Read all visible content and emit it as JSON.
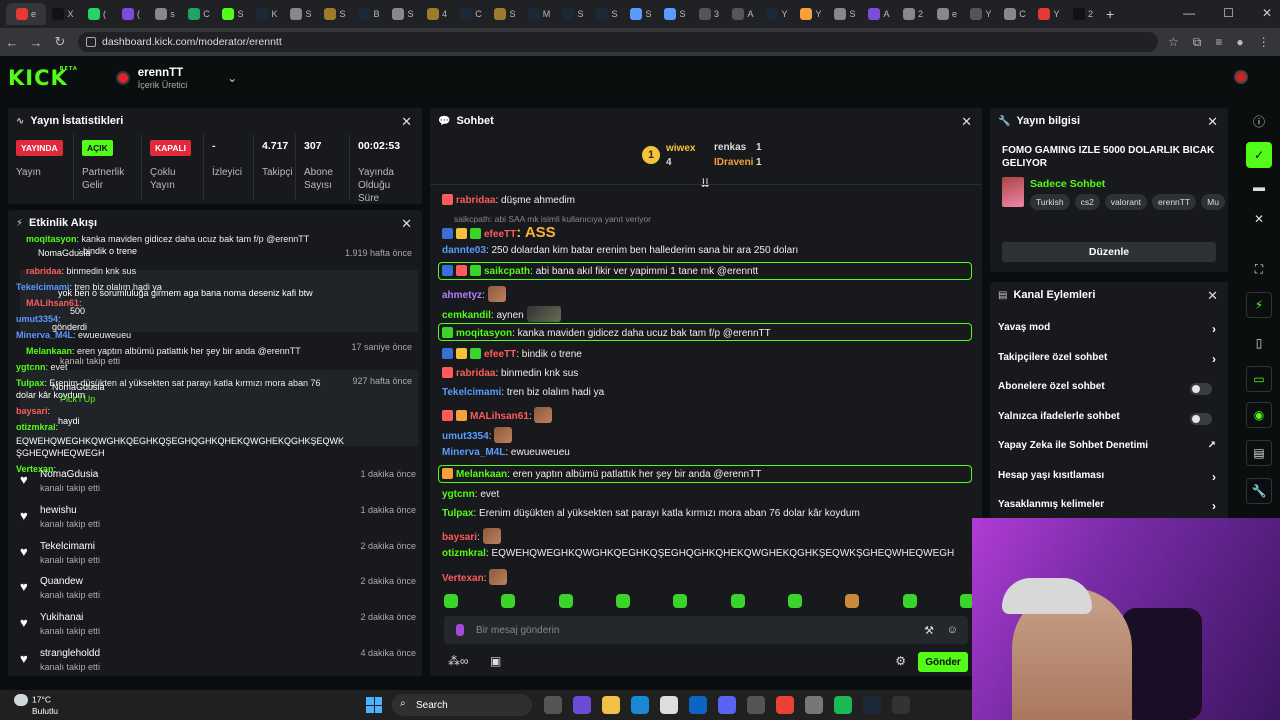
{
  "browser": {
    "url": "dashboard.kick.com/moderator/erenntt",
    "tabs": [
      "e",
      "X",
      "(",
      "(",
      "s",
      "C",
      "S",
      "K",
      "S",
      "S",
      "B",
      "S",
      "4",
      "C",
      "S",
      "M",
      "S",
      "S",
      "S",
      "S",
      "3",
      "A",
      "Y",
      "Y",
      "S",
      "A",
      "2",
      "e",
      "Y",
      "C",
      "Y",
      "2"
    ],
    "new_tab": "+"
  },
  "header": {
    "logo": "KICK",
    "logo_badge": "BETA",
    "channel_name": "erennTT",
    "channel_role": "İçerik Üretici"
  },
  "stats": {
    "title": "Yayın İstatistikleri",
    "items": [
      {
        "badge": "YAYINDA",
        "badge_color": "#e02a3b",
        "label": "Yayın"
      },
      {
        "badge": "AÇIK",
        "badge_color": "#53fc18",
        "label": "Partnerlik Gelir"
      },
      {
        "badge": "KAPALI",
        "badge_color": "#e02a3b",
        "label": "Çoklu Yayın"
      },
      {
        "value": "-",
        "label": "İzleyici"
      },
      {
        "value": "4.717",
        "label": "Takipçi"
      },
      {
        "value": "307",
        "label": "Abone Sayısı"
      },
      {
        "value": "00:02:53",
        "label": "Yayında Olduğu Süre"
      }
    ]
  },
  "activity": {
    "title": "Etkinlik Akışı",
    "overlay": [
      {
        "user": "moqitasyon",
        "color": "#53fc18",
        "text": ": kanka maviden gidicez daha ucuz bak tam f/p @erennTT"
      },
      {
        "user": "",
        "color": "#fff",
        "text": "NomaGdusia"
      },
      {
        "user": "",
        "color": "#fff",
        "text": ": bindik o trene"
      },
      {
        "user": "rabridaa",
        "color": "#ff5b5b",
        "text": ": binmedin knk sus"
      },
      {
        "user": "Tekelcimami",
        "color": "#5b9bff",
        "text": ": tren biz olalım hadi ya"
      },
      {
        "user": "",
        "color": "#fff",
        "text": "yok ben o sorumluluğa girmem aga bana noma deseniz kafi btw"
      },
      {
        "user": "MALihsan61",
        "color": "#ff5b5b",
        "text": ":"
      },
      {
        "user": "umut3354",
        "color": "#5b9bff",
        "text": ":"
      },
      {
        "user": "",
        "color": "#fff",
        "text": "500"
      },
      {
        "user": "",
        "color": "#fff",
        "text": "gönderdi"
      },
      {
        "user": "Minerva_M4L",
        "color": "#5b9bff",
        "text": ": ewueuweueu"
      },
      {
        "user": "Melankaan",
        "color": "#53fc18",
        "text": ": eren yaptın albümü patlattık her şey bir anda @erennTT"
      },
      {
        "user": "ygtcnn",
        "color": "#53fc18",
        "text": ": evet"
      },
      {
        "user": "",
        "color": "#bbb",
        "text": "kanalı takip etti"
      },
      {
        "user": "Tulpax",
        "color": "#53fc18",
        "text": ": Erenim düşükten al yüksekten sat parayı katla kırmızı mora aban 76"
      },
      {
        "user": "",
        "color": "#fff",
        "text": "dolar kâr koydum"
      },
      {
        "user": "",
        "color": "#fff",
        "text": "NomaGdusia"
      },
      {
        "user": "",
        "color": "#53fc18",
        "text": "Pick'I Up"
      },
      {
        "user": "baysari",
        "color": "#ff5b5b",
        "text": ":"
      },
      {
        "user": "",
        "color": "#fff",
        "text": "haydi"
      },
      {
        "user": "otizmkral",
        "color": "#53fc18",
        "text": ":"
      },
      {
        "user": "",
        "color": "#fff",
        "text": "EQWEHQWEGHKQWGHKQEGHKQŞEGHQGHKQHEKQWGHEKQGHKŞEQWK"
      },
      {
        "user": "",
        "color": "#fff",
        "text": "ŞGHEQWHEQWEGH"
      },
      {
        "user": "Vertexan",
        "color": "#53fc18",
        "text": ":"
      }
    ],
    "times": [
      "1.919 hafta önce",
      "17 saniye önce",
      "927 hafta önce"
    ],
    "follows": [
      {
        "name": "NomaGdusia",
        "event": "kanalı takip etti",
        "time": "1 dakika önce"
      },
      {
        "name": "hewishu",
        "event": "kanalı takip etti",
        "time": "1 dakika önce"
      },
      {
        "name": "Tekelcimami",
        "event": "kanalı takip etti",
        "time": "2 dakika önce"
      },
      {
        "name": "Quandew",
        "event": "kanalı takip etti",
        "time": "2 dakika önce"
      },
      {
        "name": "Yukihanai",
        "event": "kanalı takip etti",
        "time": "2 dakika önce"
      },
      {
        "name": "strangleholdd",
        "event": "kanalı takip etti",
        "time": "4 dakika önce"
      }
    ]
  },
  "chat": {
    "title": "Sohbet",
    "leaderboard": [
      {
        "rank": "1",
        "name": "wiwex",
        "count": "4",
        "color": "#f4c33c"
      },
      {
        "name": "renkas",
        "count": "1",
        "color": "#ddd"
      },
      {
        "name": "IDraveni",
        "count": "1",
        "color": "#f4a13c"
      }
    ],
    "messages": [
      {
        "user": "rabridaa",
        "color": "#ff5b5b",
        "text": ": düşme ahmedim"
      },
      {
        "user": "",
        "color": "#888",
        "text": "saikcpath: abi SAA mk isimli kullanıcıya yanıt veriyor"
      },
      {
        "user": "efeeTT",
        "color": "#ff5b5b",
        "text": ": ASS"
      },
      {
        "user": "dannte03",
        "color": "#5b9bff",
        "text": ": 250 dolardan kim batar erenim ben hallederim sana bir ara 250 doları"
      },
      {
        "user": "saikcpath",
        "color": "#53fc18",
        "text": ": abi bana akıl fikir ver yapimmi 1 tane mk @erenntt"
      },
      {
        "user": "ahmetyz",
        "color": "#b77cff",
        "text": ":"
      },
      {
        "user": "cemkandil",
        "color": "#53fc18",
        "text": ": aynen"
      },
      {
        "user": "moqitasyon",
        "color": "#53fc18",
        "text": ": kanka maviden gidicez daha ucuz bak tam f/p @erennTT"
      },
      {
        "user": "efeeTT",
        "color": "#ff5b5b",
        "text": ": bindik o trene"
      },
      {
        "user": "rabridaa",
        "color": "#ff5b5b",
        "text": ": binmedin knk sus"
      },
      {
        "user": "Tekelcimami",
        "color": "#5b9bff",
        "text": ": tren biz olalım hadi ya"
      },
      {
        "user": "MALihsan61",
        "color": "#ff5b5b",
        "text": ":"
      },
      {
        "user": "umut3354",
        "color": "#5b9bff",
        "text": ":"
      },
      {
        "user": "Minerva_M4L",
        "color": "#5b9bff",
        "text": ": ewueuweueu"
      },
      {
        "user": "Melankaan",
        "color": "#53fc18",
        "text": ": eren yaptın albümü patlattık her şey bir anda @erennTT"
      },
      {
        "user": "ygtcnn",
        "color": "#53fc18",
        "text": ": evet"
      },
      {
        "user": "Tulpax",
        "color": "#53fc18",
        "text": ": Erenim düşükten al yüksekten sat parayı katla kırmızı mora aban 76 dolar kâr koydum"
      },
      {
        "user": "baysari",
        "color": "#ff5b5b",
        "text": ":"
      },
      {
        "user": "otizmkral",
        "color": "#53fc18",
        "text": ": EQWEHQWEGHKQWGHKQEGHKQŞEGHQGHKQHEKQWGHEKQGHKŞEQWKŞGHEQWHEQWEGH"
      },
      {
        "user": "Vertexan",
        "color": "#ff5b5b",
        "text": ":"
      }
    ],
    "input_placeholder": "Bir mesaj gönderin",
    "send_label": "Gönder"
  },
  "info": {
    "title": "Yayın bilgisi",
    "stream_title": "FOMO GAMING IZLE 5000 DOLARLIK BICAK GELIYOR",
    "category": "Sadece Sohbet",
    "tags": [
      "Turkish",
      "cs2",
      "valorant",
      "erennTT",
      "Mu"
    ],
    "edit_label": "Düzenle"
  },
  "actions": {
    "title": "Kanal Eylemleri",
    "items": [
      {
        "label": "Yavaş mod",
        "kind": "arrow"
      },
      {
        "label": "Takipçilere özel sohbet",
        "kind": "arrow"
      },
      {
        "label": "Abonelere özel sohbet",
        "kind": "toggle"
      },
      {
        "label": "Yalnızca ifadelerle sohbet",
        "kind": "toggle"
      },
      {
        "label": "Yapay Zeka ile Sohbet Denetimi",
        "kind": "external"
      },
      {
        "label": "Hesap yaşı kısıtlaması",
        "kind": "arrow"
      },
      {
        "label": "Yasaklanmış kelimeler",
        "kind": "arrow"
      }
    ]
  },
  "taskbar": {
    "temp": "17°C",
    "weather": "Bulutlu",
    "search": "Search"
  }
}
